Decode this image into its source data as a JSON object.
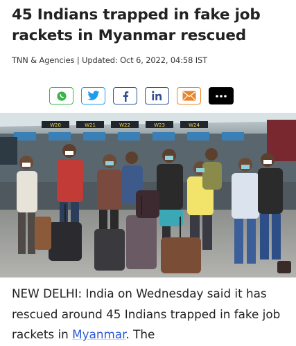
{
  "headline": "45 Indians trapped in fake job rackets in Myanmar rescued",
  "byline": "TNN & Agencies | Updated: Oct 6, 2022, 04:58 IST",
  "share": [
    {
      "name": "whatsapp-icon",
      "color": "#3ab54a"
    },
    {
      "name": "twitter-icon",
      "color": "#1d9bf0"
    },
    {
      "name": "facebook-icon",
      "color": "#2f4f90"
    },
    {
      "name": "linkedin-icon",
      "color": "#2f4f90"
    },
    {
      "name": "mail-icon",
      "color": "#e8842b"
    },
    {
      "name": "more-icon",
      "color": "#000000"
    }
  ],
  "photo": {
    "gate_signs": [
      "W20",
      "W21",
      "W22",
      "W23",
      "W24"
    ]
  },
  "article": {
    "text_before_link": "NEW DELHI: India on Wednesday said it has rescued around 45 Indians trapped in fake job rackets in ",
    "link_text": "Myanmar",
    "text_after_link": ". The"
  }
}
